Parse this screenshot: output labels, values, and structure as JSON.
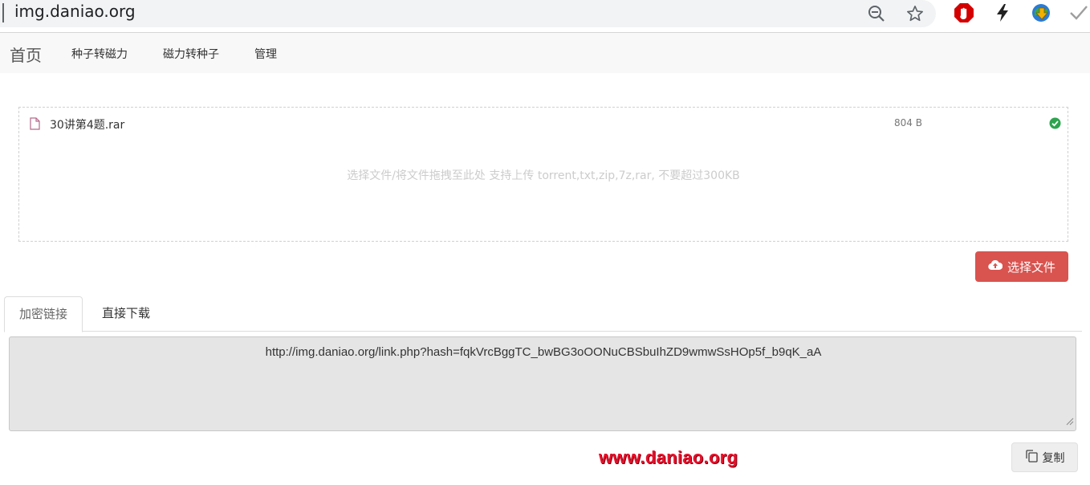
{
  "browser": {
    "url": "img.daniao.org",
    "icons": [
      "zoom-out-icon",
      "star-icon",
      "adblock-icon",
      "bolt-icon",
      "idm-icon",
      "checkmark-icon"
    ]
  },
  "nav": {
    "brand": "首页",
    "links": [
      "种子转磁力",
      "磁力转种子",
      "管理"
    ]
  },
  "upload": {
    "file": {
      "name": "30讲第4题.rar",
      "size": "804 B",
      "status": "uploaded"
    },
    "hint": "选择文件/将文件拖拽至此处 支持上传 torrent,txt,zip,7z,rar, 不要超过300KB",
    "choose_label": "选择文件"
  },
  "tabs": [
    "加密链接",
    "直接下载"
  ],
  "result": {
    "link": "http://img.daniao.org/link.php?hash=fqkVrcBggTC_bwBG3oOONuCBSbuIhZD9wmwSsHOp5f_b9qK_aA"
  },
  "watermark": "www.daniao.org",
  "copy_label": "复制",
  "colors": {
    "primary_danger": "#d9534f",
    "success": "#2ea44f",
    "watermark": "#e8102a"
  }
}
